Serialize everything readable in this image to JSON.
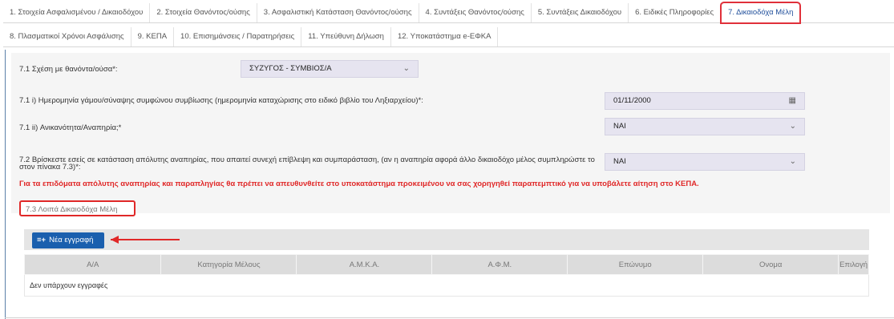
{
  "tabs_row1": [
    "1. Στοιχεία Ασφαλισμένου / Δικαιοδόχου",
    "2. Στοιχεία Θανόντος/ούσης",
    "3. Ασφαλιστική Κατάσταση Θανόντος/ούσης",
    "4. Συντάξεις Θανόντος/ούσης",
    "5. Συντάξεις Δικαιοδόχου",
    "6. Ειδικές Πληροφορίες",
    "7. Δικαιοδόχα Μέλη"
  ],
  "tabs_row2": [
    "8. Πλασματικοί Χρόνοι Ασφάλισης",
    "9. ΚΕΠΑ",
    "10. Επισημάνσεις / Παρατηρήσεις",
    "11. Υπεύθυνη Δήλωση",
    "12. Υποκατάστημα e-ΕΦΚΑ"
  ],
  "form": {
    "relation_label": "7.1 Σχέση με θανόντα/ούσα*:",
    "relation_value": "ΣΥΖΥΓΟΣ - ΣΥΜΒΙΟΣ/Α",
    "marriage_date_label": "7.1 i) Ημερομηνία γάμου/σύναψης συμφώνου συμβίωσης (ημερομηνία καταχώρισης στο ειδικό βιβλίο του Ληξιαρχείου)*:",
    "marriage_date_value": "01/11/2000",
    "disability_label": "7.1 ii) Ανικανότητα/Αναπηρία;*",
    "disability_value": "ΝΑΙ",
    "full_disability_label_line1": "7.2 Βρίσκεστε εσείς σε κατάσταση απόλυτης αναπηρίας, που απαιτεί συνεχή επίβλεψη και συμπαράσταση, (αν η αναπηρία αφορά άλλο δικαιοδόχο μέλος συμπληρώστε το",
    "full_disability_label_line2": "στον πίνακα 7.3)*:",
    "full_disability_value": "ΝΑΙ"
  },
  "warning_text": "Για τα επιδόματα απόλυτης αναπηρίας και παραπληγίας θα πρέπει να απευθυνθείτε στο υποκατάστημα προκειμένου να σας χορηγηθεί παραπεμπτικό για να υποβάλετε αίτηση στο ΚΕΠΑ.",
  "members_section": {
    "title": "7.3 Λοιπά Δικαιοδόχα Μέλη",
    "new_button_label": "Νέα εγγραφή",
    "columns": [
      "Α/Α",
      "Κατηγορία Μέλους",
      "Α.Μ.Κ.Α.",
      "Α.Φ.Μ.",
      "Επώνυμο",
      "Ονομα",
      "Επιλογή"
    ],
    "empty_text": "Δεν υπάρχουν εγγραφές"
  },
  "icons": {
    "dropdown": "chevron-down-icon",
    "calendar": "calendar-icon",
    "add": "add-list-icon"
  }
}
